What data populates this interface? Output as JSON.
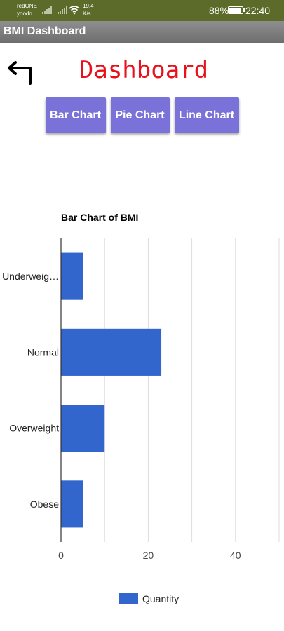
{
  "status_bar": {
    "carrier_1": "redONE",
    "carrier_2": "yoodo",
    "speed_value": "19.4",
    "speed_unit": "K/s",
    "battery": "88%",
    "battery_level": 0.88,
    "time": "22:40",
    "icons": [
      "signal-icon",
      "signal-icon",
      "wifi-icon",
      "battery-icon"
    ]
  },
  "app_bar": {
    "title": "BMI Dashboard"
  },
  "header": {
    "back_icon": "arrow-back-icon",
    "title": "Dashboard"
  },
  "chart_tabs": {
    "bar": "Bar Chart",
    "pie": "Pie Chart",
    "line": "Line Chart",
    "color": "#7b72d9"
  },
  "colors": {
    "title": "#e8111b",
    "bar": "#3366cc"
  },
  "chart_data": {
    "type": "bar",
    "orientation": "horizontal",
    "title": "Bar Chart of BMI",
    "categories": [
      "Underweig…",
      "Normal",
      "Overweight",
      "Obese"
    ],
    "series": [
      {
        "name": "Quantity",
        "values": [
          5,
          23,
          10,
          5
        ]
      }
    ],
    "xlim": [
      0,
      50
    ],
    "xticks": [
      0,
      20,
      40
    ],
    "grid": true,
    "legend": "bottom"
  }
}
